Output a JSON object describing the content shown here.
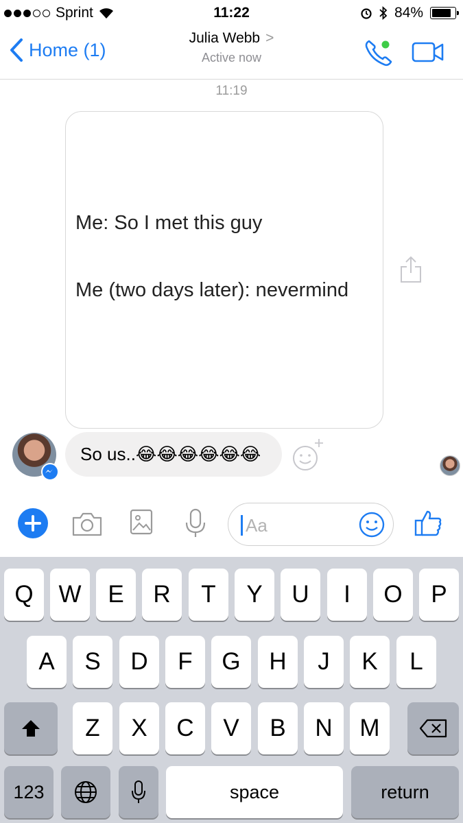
{
  "status_bar": {
    "carrier": "Sprint",
    "time": "11:22",
    "battery": "84%",
    "battery_level": 0.84
  },
  "nav": {
    "back_label": "Home (1)",
    "contact_name": "Julia Webb",
    "contact_status": "Active now",
    "chevron": ">"
  },
  "chat": {
    "timestamp": "11:19",
    "image_message": {
      "line1": "Me: So I met this guy",
      "line2": "Me (two days later): nevermind"
    },
    "text_message": "So us..😂😂😂😂😂😂"
  },
  "composer": {
    "placeholder": "Aa"
  },
  "keyboard": {
    "row1": [
      "Q",
      "W",
      "E",
      "R",
      "T",
      "Y",
      "U",
      "I",
      "O",
      "P"
    ],
    "row2": [
      "A",
      "S",
      "D",
      "F",
      "G",
      "H",
      "J",
      "K",
      "L"
    ],
    "row3": [
      "Z",
      "X",
      "C",
      "V",
      "B",
      "N",
      "M"
    ],
    "numbers_label": "123",
    "space_label": "space",
    "return_label": "return"
  },
  "icons": {
    "accent_color": "#1d7cf2"
  }
}
